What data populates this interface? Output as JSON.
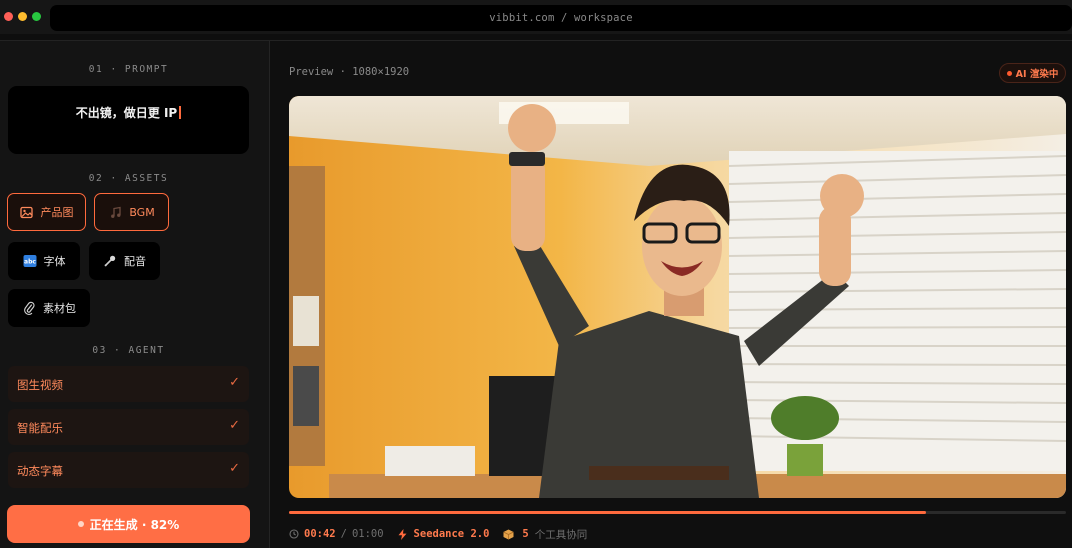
{
  "window": {
    "url": "vibbit.com / workspace"
  },
  "sidebar": {
    "prompt_section": "01 · PROMPT",
    "prompt_text": "不出镜，做日更 IP",
    "assets_section": "02 · ASSETS",
    "assets": [
      {
        "label": "产品图",
        "icon": "image-icon",
        "active": true
      },
      {
        "label": "BGM",
        "icon": "music-note-icon",
        "active": true
      },
      {
        "label": "字体",
        "icon": "font-icon",
        "active": false
      },
      {
        "label": "配音",
        "icon": "microphone-icon",
        "active": false
      },
      {
        "label": "素材包",
        "icon": "paperclip-icon",
        "active": false
      }
    ],
    "agent_section": "03 · AGENT",
    "agents": [
      {
        "label": "图生视频",
        "status": "✓"
      },
      {
        "label": "智能配乐",
        "status": "✓"
      },
      {
        "label": "动态字幕",
        "status": "✓"
      }
    ],
    "generate_button": {
      "label": "正在生成 · 82%",
      "progress": 0.82
    }
  },
  "preview": {
    "label": "Preview · 1080×1920",
    "badge": "AI 渲染中",
    "playback_progress": 0.82,
    "current_time": "00:42",
    "time_separator": "/",
    "duration": "01:00",
    "model": "Seedance 2.0",
    "tools_count": "5",
    "tools_label": "个工具协同"
  },
  "colors": {
    "accent": "#ff6a3d",
    "button": "#ff6e45",
    "background": "#0e0e0e"
  }
}
